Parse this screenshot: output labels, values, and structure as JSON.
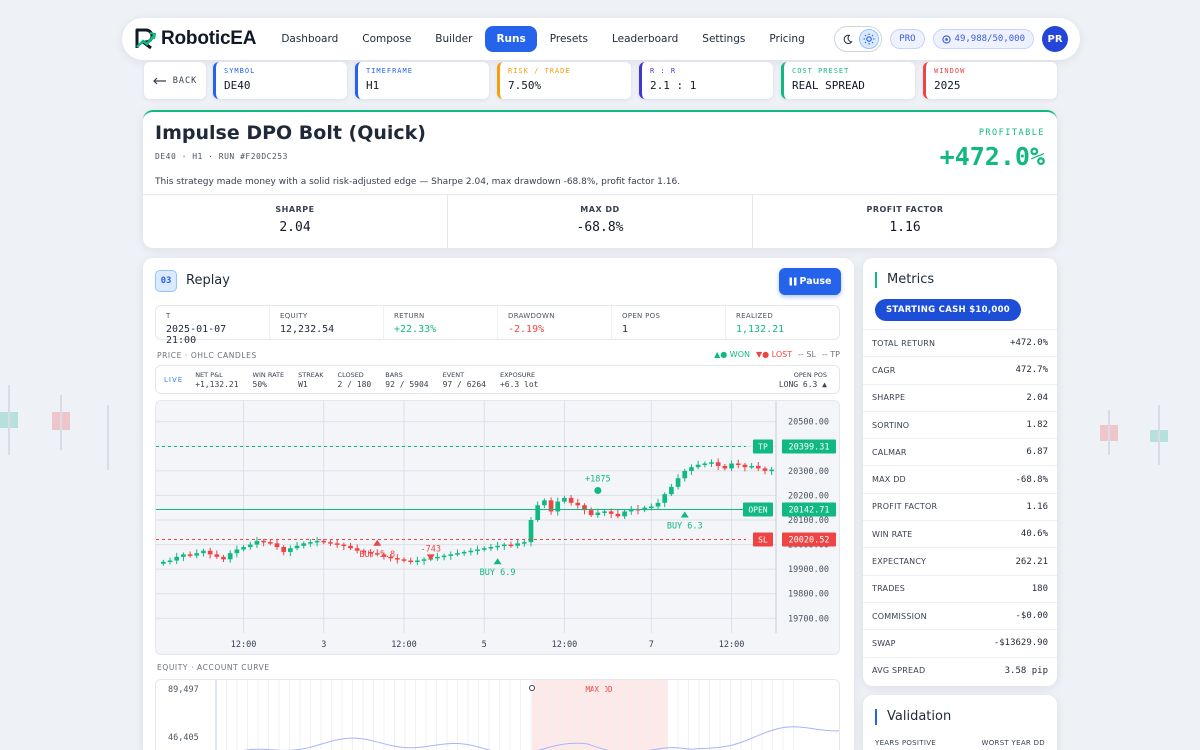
{
  "brand": {
    "name": "RoboticEA"
  },
  "nav": {
    "items": [
      "Dashboard",
      "Compose",
      "Builder",
      "Runs",
      "Presets",
      "Leaderboard",
      "Settings",
      "Pricing"
    ],
    "active_index": 3,
    "plan_badge": "PRO",
    "credits": "49,988/50,000",
    "avatar_initials": "PR"
  },
  "params": {
    "back_label": "BACK",
    "items": [
      {
        "label": "SYMBOL",
        "value": "DE40",
        "color": "#2563eb"
      },
      {
        "label": "TIMEFRAME",
        "value": "H1",
        "color": "#2563eb"
      },
      {
        "label": "RISK / TRADE",
        "value": "7.50%",
        "color": "#f59e0b"
      },
      {
        "label": "R : R",
        "value": "2.1 : 1",
        "color": "#4338ca"
      },
      {
        "label": "COST PRESET",
        "value": "REAL SPREAD",
        "color": "#10b981"
      },
      {
        "label": "WINDOW",
        "value": "2025",
        "color": "#ef4444"
      }
    ]
  },
  "summary": {
    "title": "Impulse DPO Bolt (Quick)",
    "subtitle": "DE40 · H1 · RUN #F20DC253",
    "description": "This strategy made money with a solid risk-adjusted edge — Sharpe 2.04, max drawdown -68.8%, profit factor 1.16.",
    "status": "PROFITABLE",
    "profit": "+472.0%",
    "kpis": [
      {
        "label": "SHARPE",
        "value": "2.04"
      },
      {
        "label": "MAX DD",
        "value": "-68.8%"
      },
      {
        "label": "PROFIT FACTOR",
        "value": "1.16"
      }
    ]
  },
  "replay": {
    "step": "03",
    "title": "Replay",
    "pause_label": "Pause",
    "stats": [
      {
        "label": "T",
        "value": "2025-01-07 21:00",
        "tone": ""
      },
      {
        "label": "EQUITY",
        "value": "12,232.54",
        "tone": ""
      },
      {
        "label": "RETURN",
        "value": "+22.33%",
        "tone": "green"
      },
      {
        "label": "DRAWDOWN",
        "value": "-2.19%",
        "tone": "red"
      },
      {
        "label": "OPEN POS",
        "value": "1",
        "tone": ""
      },
      {
        "label": "REALIZED",
        "value": "1,132.21",
        "tone": "green"
      }
    ],
    "price_label": "PRICE · OHLC CANDLES",
    "legend": {
      "won": "▲● WON",
      "lost": "▼● LOST",
      "sl": "-- SL",
      "tp": "-- TP"
    },
    "live": {
      "tag": "LIVE",
      "items": [
        {
          "label": "NET P&L",
          "value": "+1,132.21",
          "tone": "green"
        },
        {
          "label": "WIN RATE",
          "value": "50%",
          "tone": ""
        },
        {
          "label": "STREAK",
          "value": "W1",
          "tone": "green"
        },
        {
          "label": "CLOSED",
          "value": "2 / 180",
          "tone": ""
        },
        {
          "label": "BARS",
          "value": "92 / 5904",
          "tone": ""
        },
        {
          "label": "EVENT",
          "value": "97 / 6264",
          "tone": ""
        },
        {
          "label": "EXPOSURE",
          "value": "+6.3 lot",
          "tone": "green"
        }
      ],
      "open_pos_label": "OPEN POS",
      "open_pos_value": "LONG 6.3 ▲"
    },
    "equity_label": "EQUITY · ACCOUNT CURVE"
  },
  "chart_data": [
    {
      "type": "candlestick",
      "title": "PRICE · OHLC CANDLES",
      "ylim": [
        19640,
        20560
      ],
      "y_ticks": [
        20500,
        20400,
        20300,
        20200,
        20100,
        20000,
        19900,
        19800,
        19700
      ],
      "y_tick_labels": [
        "20500.00",
        "20400.00",
        "20300.00",
        "20200.00",
        "20100.00",
        "20000.00",
        "19900.00",
        "19800.00",
        "19700.00"
      ],
      "x_ticks": [
        {
          "index": 12,
          "label": "12:00"
        },
        {
          "index": 24,
          "label": "3"
        },
        {
          "index": 36,
          "label": "12:00"
        },
        {
          "index": 48,
          "label": "5"
        },
        {
          "index": 60,
          "label": "12:00"
        },
        {
          "index": 73,
          "label": "7"
        },
        {
          "index": 85,
          "label": "12:00"
        }
      ],
      "closes": [
        19930,
        19935,
        19950,
        19960,
        19955,
        19965,
        19975,
        19960,
        19950,
        19940,
        19965,
        19980,
        19990,
        20000,
        20015,
        20010,
        20005,
        19990,
        19970,
        19985,
        19995,
        20005,
        20010,
        20015,
        20010,
        20005,
        20000,
        19995,
        19985,
        19975,
        19970,
        19965,
        19960,
        19950,
        19945,
        19940,
        19935,
        19930,
        19935,
        19940,
        19945,
        19950,
        19955,
        19960,
        19965,
        19970,
        19975,
        19980,
        19985,
        19990,
        19995,
        20000,
        19995,
        20005,
        20010,
        20100,
        20160,
        20180,
        20135,
        20175,
        20190,
        20170,
        20160,
        20140,
        20120,
        20130,
        20135,
        20125,
        20115,
        20135,
        20145,
        20140,
        20150,
        20155,
        20170,
        20205,
        20235,
        20270,
        20300,
        20315,
        20325,
        20330,
        20335,
        20320,
        20310,
        20330,
        20325,
        20315,
        20320,
        20310,
        20300,
        20305
      ],
      "levels": [
        {
          "name": "TP",
          "value": "20399.31",
          "y": 20399.31,
          "color": "#10b981"
        },
        {
          "name": "OPEN",
          "value": "20142.71",
          "y": 20142.71,
          "color": "#10b981"
        },
        {
          "name": "SL",
          "value": "20020.52",
          "y": 20020.52,
          "color": "#ef4444"
        }
      ],
      "annotations": [
        {
          "text": "BUY 5.8",
          "index": 32,
          "price": 19995,
          "color": "#ef4444",
          "dir": "up"
        },
        {
          "text": "-743",
          "index": 40,
          "price": 19960,
          "color": "#ef4444",
          "dir": "down"
        },
        {
          "text": "BUY 6.9",
          "index": 50,
          "price": 19920,
          "color": "#10b981",
          "dir": "up"
        },
        {
          "text": "+1875",
          "index": 65,
          "price": 20220,
          "color": "#10b981",
          "dir": "dot"
        },
        {
          "text": "BUY 6.3",
          "index": 78,
          "price": 20110,
          "color": "#10b981",
          "dir": "up"
        }
      ]
    },
    {
      "type": "line",
      "title": "EQUITY · ACCOUNT CURVE",
      "y_tick_labels": [
        "89,497",
        "46,405"
      ],
      "x": [
        0,
        1
      ],
      "drawdown_label": "MAX DD"
    }
  ],
  "metrics": {
    "title": "Metrics",
    "starting_cash": "STARTING CASH $10,000",
    "rows": [
      {
        "label": "TOTAL RETURN",
        "value": "+472.0%",
        "tone": "green"
      },
      {
        "label": "CAGR",
        "value": "472.7%",
        "tone": "green"
      },
      {
        "label": "SHARPE",
        "value": "2.04",
        "tone": ""
      },
      {
        "label": "SORTINO",
        "value": "1.82",
        "tone": ""
      },
      {
        "label": "CALMAR",
        "value": "6.87",
        "tone": ""
      },
      {
        "label": "MAX DD",
        "value": "-68.8%",
        "tone": "red"
      },
      {
        "label": "PROFIT FACTOR",
        "value": "1.16",
        "tone": ""
      },
      {
        "label": "WIN RATE",
        "value": "40.6%",
        "tone": ""
      },
      {
        "label": "EXPECTANCY",
        "value": "262.21",
        "tone": ""
      },
      {
        "label": "TRADES",
        "value": "180",
        "tone": ""
      },
      {
        "label": "COMMISSION",
        "value": "-$0.00",
        "tone": "red"
      },
      {
        "label": "SWAP",
        "value": "-$13629.90",
        "tone": "red"
      },
      {
        "label": "AVG SPREAD",
        "value": "3.58 pip",
        "tone": ""
      }
    ]
  },
  "validation": {
    "title": "Validation",
    "left_label": "YEARS POSITIVE",
    "right_label": "WORST YEAR DD"
  },
  "colors": {
    "accent": "#2563eb",
    "up": "#10b981",
    "down": "#ef4444"
  }
}
